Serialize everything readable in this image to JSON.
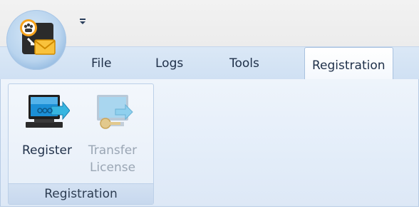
{
  "quick_access": {
    "dropdown_icon": "chevron-down-icon"
  },
  "tabs": [
    {
      "label": "File"
    },
    {
      "label": "Logs"
    },
    {
      "label": "Tools"
    },
    {
      "label": "Registration"
    }
  ],
  "active_tab": "Registration",
  "ribbon": {
    "group_label": "Registration",
    "register_label": "Register",
    "transfer_label_line1": "Transfer",
    "transfer_label_line2": "License"
  },
  "colors": {
    "accent": "#cfe0f3",
    "text": "#1e2f48",
    "disabled_text": "#9aa6b4"
  }
}
